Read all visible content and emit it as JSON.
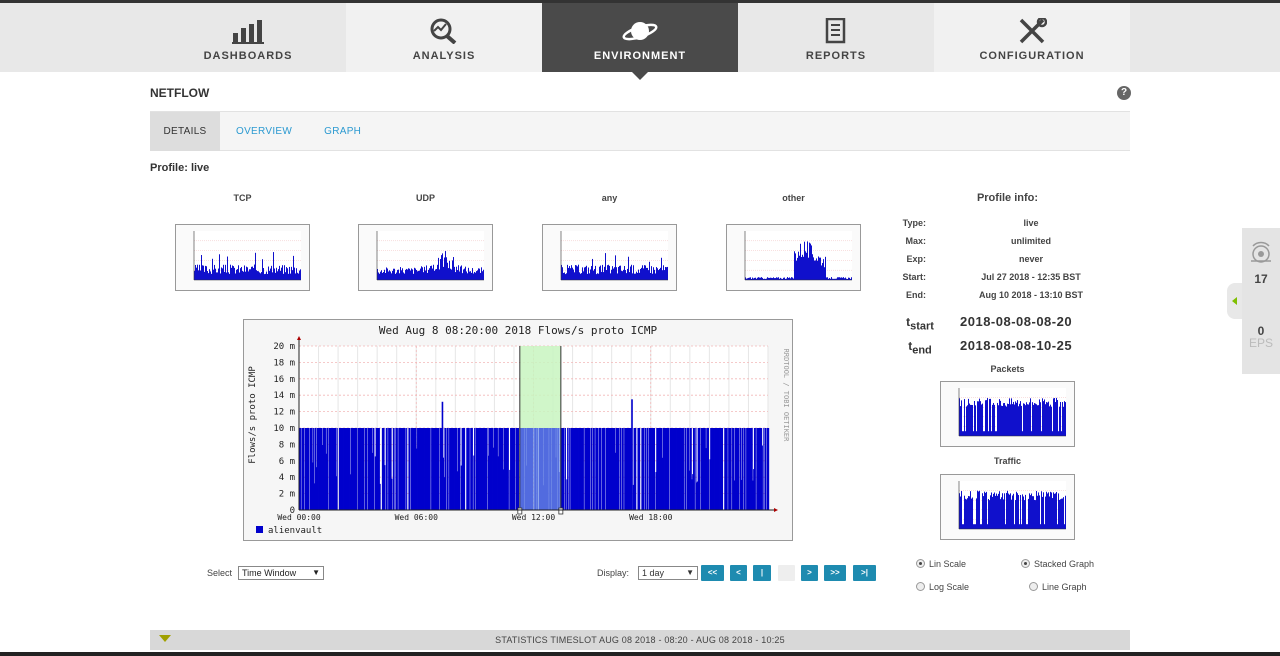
{
  "nav": {
    "items": [
      {
        "label": "DASHBOARDS",
        "icon": "bar-chart-icon"
      },
      {
        "label": "ANALYSIS",
        "icon": "magnifier-analysis-icon"
      },
      {
        "label": "ENVIRONMENT",
        "icon": "planet-icon"
      },
      {
        "label": "REPORTS",
        "icon": "document-icon"
      },
      {
        "label": "CONFIGURATION",
        "icon": "tools-icon"
      }
    ],
    "active": "ENVIRONMENT"
  },
  "page": {
    "title": "NETFLOW",
    "help": "?"
  },
  "tabs": [
    {
      "label": "DETAILS"
    },
    {
      "label": "OVERVIEW"
    },
    {
      "label": "GRAPH"
    }
  ],
  "profile": {
    "label": "Profile: live"
  },
  "thumbs": [
    {
      "title": "TCP"
    },
    {
      "title": "UDP"
    },
    {
      "title": "any"
    },
    {
      "title": "other"
    }
  ],
  "profile_info": {
    "title": "Profile info:",
    "rows": [
      {
        "key": "Type:",
        "value": "live"
      },
      {
        "key": "Max:",
        "value": "unlimited"
      },
      {
        "key": "Exp:",
        "value": "never"
      },
      {
        "key": "Start:",
        "value": "Jul 27 2018 - 12:35 BST"
      },
      {
        "key": "End:",
        "value": "Aug 10 2018 - 13:10 BST"
      }
    ],
    "tstart_label": "start",
    "tstart_value": "2018-08-08-08-20",
    "tend_label": "end",
    "tend_value": "2018-08-08-10-25",
    "packets_title": "Packets",
    "traffic_title": "Traffic"
  },
  "chart_data": {
    "type": "area",
    "title": "Wed Aug  8 08:20:00 2018 Flows/s proto ICMP",
    "ylabel": "Flows/s proto ICMP",
    "side_label": "RRDTOOL / TOBI OETIKER",
    "ytick_labels": [
      "0",
      "2 m",
      "4 m",
      "6 m",
      "8 m",
      "10 m",
      "12 m",
      "14 m",
      "16 m",
      "18 m",
      "20 m"
    ],
    "ylim": [
      0,
      20
    ],
    "xtick_labels": [
      "Wed 00:00",
      "Wed 06:00",
      "Wed 12:00",
      "Wed 18:00"
    ],
    "xlim_hours": [
      0,
      24
    ],
    "series": [
      {
        "name": "alienvault",
        "color": "#0000cc",
        "baseline": 10
      }
    ],
    "spikes": [
      {
        "hour": 7.3,
        "value": 13.2
      },
      {
        "hour": 17.0,
        "value": 13.5
      }
    ],
    "selection_hours": [
      11.3,
      13.4
    ],
    "selection_color": "#c8f5c0",
    "legend": "alienvault"
  },
  "controls": {
    "select_label": "Select",
    "select_value": "Time Window",
    "display_label": "Display:",
    "display_value": "1 day",
    "buttons": [
      "<<",
      "<",
      "|",
      "",
      ">",
      ">>",
      ">|"
    ]
  },
  "options": {
    "lin_scale": "Lin Scale",
    "log_scale": "Log Scale",
    "stacked_graph": "Stacked Graph",
    "line_graph": "Line Graph",
    "lin_selected": true,
    "stacked_selected": true
  },
  "status_bar": {
    "text": "STATISTICS TIMESLOT AUG 08 2018 - 08:20 - AUG 08 2018 - 10:25"
  },
  "right_panel": {
    "count": "17",
    "eps_count": "0",
    "eps_label": "EPS"
  }
}
